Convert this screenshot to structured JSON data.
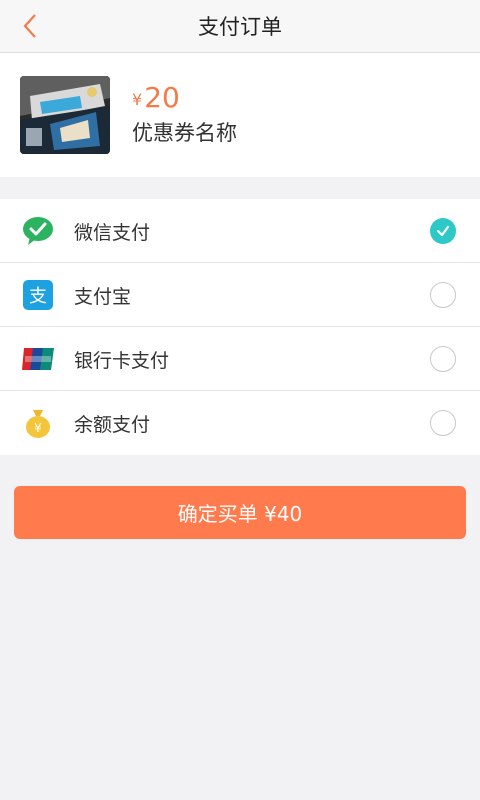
{
  "header": {
    "title": "支付订单"
  },
  "coupon": {
    "currency": "¥",
    "price": "20",
    "name": "优惠券名称"
  },
  "payment_methods": [
    {
      "label": "微信支付",
      "icon": "wechat-pay-icon",
      "selected": true
    },
    {
      "label": "支付宝",
      "icon": "alipay-icon",
      "selected": false
    },
    {
      "label": "银行卡支付",
      "icon": "unionpay-card-icon",
      "selected": false
    },
    {
      "label": "余额支付",
      "icon": "money-bag-icon",
      "selected": false
    }
  ],
  "confirm": {
    "label": "确定买单 ¥40"
  },
  "colors": {
    "accent": "#ff7a4c",
    "price": "#f47a4a",
    "selected": "#2ec8c7",
    "wechat": "#2bb35f",
    "alipay": "#1ea1e0"
  }
}
